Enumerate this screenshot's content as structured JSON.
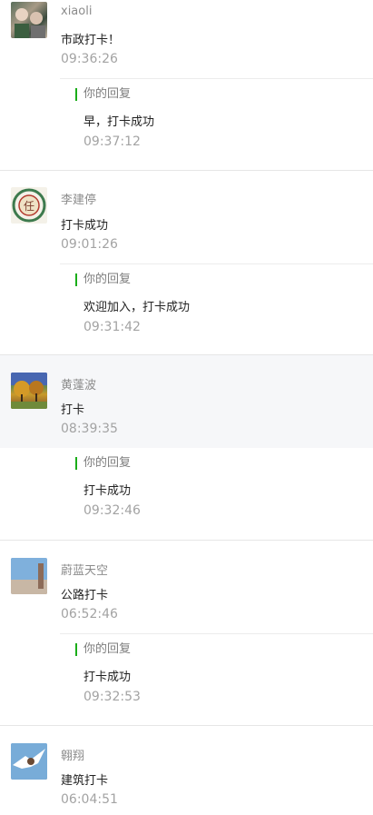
{
  "messages": [
    {
      "avatar_icon": "avatar-photo-children",
      "name": "xiaoli",
      "text": "市政打卡！",
      "time": "09:36:26",
      "reply": {
        "label": "你的回复",
        "text": "早，打卡成功",
        "time": "09:37:12"
      }
    },
    {
      "avatar_icon": "avatar-emblem",
      "name": "李建停",
      "text": "打卡成功",
      "time": "09:01:26",
      "reply": {
        "label": "你的回复",
        "text": "欢迎加入，打卡成功",
        "time": "09:31:42"
      }
    },
    {
      "avatar_icon": "avatar-autumn-trees",
      "name": "黄蓬波",
      "text": "打卡",
      "time": "08:39:35",
      "reply": {
        "label": "你的回复",
        "text": "打卡成功",
        "time": "09:32:46"
      }
    },
    {
      "avatar_icon": "avatar-sky-building",
      "name": "蔚蓝天空",
      "text": "公路打卡",
      "time": "06:52:46",
      "reply": {
        "label": "你的回复",
        "text": "打卡成功",
        "time": "09:32:53"
      }
    },
    {
      "avatar_icon": "avatar-eagle",
      "name": "翱翔",
      "text": "建筑打卡",
      "time": "06:04:51"
    }
  ],
  "colors": {
    "reply_bar": "#1aad19",
    "highlight_bg": "#f6f7f9"
  }
}
